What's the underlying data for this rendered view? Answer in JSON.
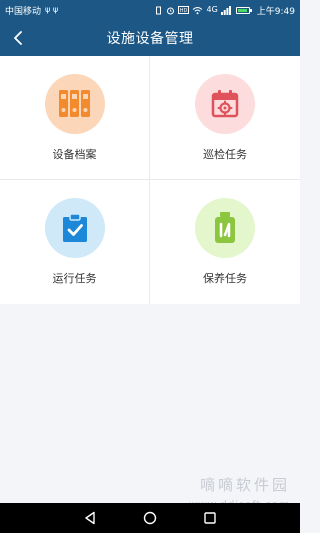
{
  "status_bar": {
    "carrier": "中国移动",
    "signal_icons": "ψ ψ",
    "network": "4G",
    "time": "上午9:49"
  },
  "header": {
    "title": "设施设备管理"
  },
  "menu": [
    {
      "label": "设备档案",
      "icon": "binders-icon",
      "bg_color": "#fbd6b8",
      "icon_color": "#f28a2e"
    },
    {
      "label": "巡检任务",
      "icon": "calendar-gear-icon",
      "bg_color": "#fcdcdc",
      "icon_color": "#e0525b"
    },
    {
      "label": "运行任务",
      "icon": "clipboard-check-icon",
      "bg_color": "#cfe9f8",
      "icon_color": "#1e88d8"
    },
    {
      "label": "保养任务",
      "icon": "oil-can-icon",
      "bg_color": "#e4f6cb",
      "icon_color": "#8cc63f"
    }
  ],
  "watermark": {
    "text": "嘀嘀软件园",
    "url": "www.ddisoft.com"
  },
  "colors": {
    "primary": "#1c5785",
    "background": "#f3f5f8"
  }
}
